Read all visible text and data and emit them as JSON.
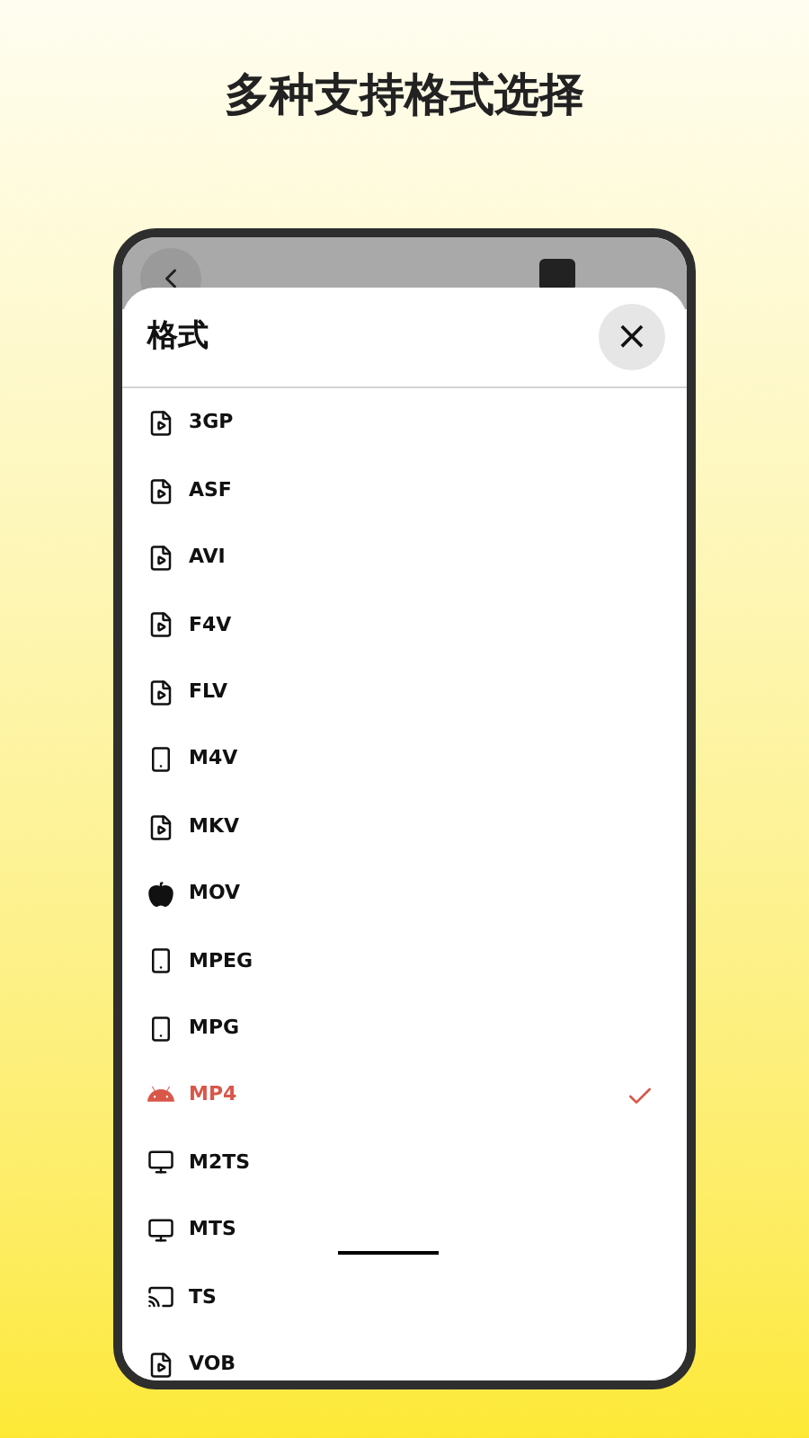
{
  "headline": "多种支持格式选择",
  "sheet": {
    "title": "格式",
    "close": "×",
    "items": [
      {
        "label": "3GP",
        "kind": "file",
        "selected": false
      },
      {
        "label": "ASF",
        "kind": "file",
        "selected": false
      },
      {
        "label": "AVI",
        "kind": "file",
        "selected": false
      },
      {
        "label": "F4V",
        "kind": "file",
        "selected": false
      },
      {
        "label": "FLV",
        "kind": "file",
        "selected": false
      },
      {
        "label": "M4V",
        "kind": "phone",
        "selected": false
      },
      {
        "label": "MKV",
        "kind": "file",
        "selected": false
      },
      {
        "label": "MOV",
        "kind": "apple",
        "selected": false
      },
      {
        "label": "MPEG",
        "kind": "phone",
        "selected": false
      },
      {
        "label": "MPG",
        "kind": "phone",
        "selected": false
      },
      {
        "label": "MP4",
        "kind": "android",
        "selected": true
      },
      {
        "label": "M2TS",
        "kind": "monitor",
        "selected": false
      },
      {
        "label": "MTS",
        "kind": "monitor",
        "selected": false
      },
      {
        "label": "TS",
        "kind": "cast",
        "selected": false
      },
      {
        "label": "VOB",
        "kind": "file",
        "selected": false
      }
    ]
  }
}
